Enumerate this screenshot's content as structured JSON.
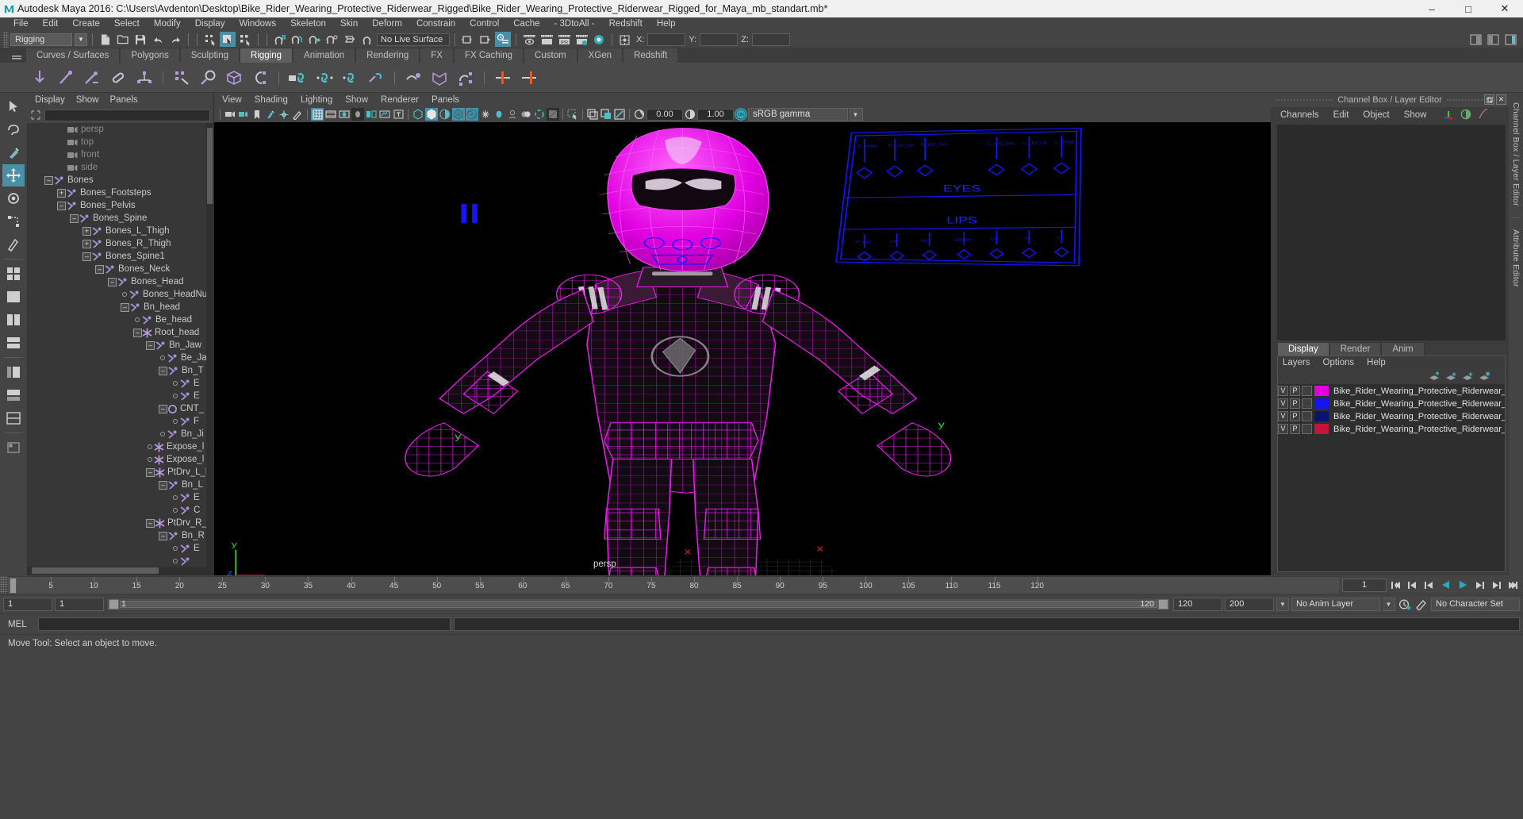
{
  "window": {
    "title": "Autodesk Maya 2016: C:\\Users\\Avdenton\\Desktop\\Bike_Rider_Wearing_Protective_Riderwear_Rigged\\Bike_Rider_Wearing_Protective_Riderwear_Rigged_for_Maya_mb_standart.mb*",
    "app_icon": "maya-logo-icon",
    "minimize": "–",
    "maximize": "□",
    "close": "✕"
  },
  "menubar": {
    "items": [
      "File",
      "Edit",
      "Create",
      "Select",
      "Modify",
      "Display",
      "Windows",
      "Skeleton",
      "Skin",
      "Deform",
      "Constrain",
      "Control",
      "Cache",
      "- 3DtoAll -",
      "Redshift",
      "Help"
    ]
  },
  "statusline": {
    "mode": "Rigging",
    "live_surface": "No Live Surface",
    "coord_labels": [
      "X:",
      "Y:",
      "Z:"
    ],
    "coord_values": [
      "",
      "",
      ""
    ]
  },
  "shelf": {
    "tabs": [
      "Curves / Surfaces",
      "Polygons",
      "Sculpting",
      "Rigging",
      "Animation",
      "Rendering",
      "FX",
      "FX Caching",
      "Custom",
      "XGen",
      "Redshift"
    ],
    "active_tab": "Rigging"
  },
  "outliner": {
    "menus": [
      "Display",
      "Show",
      "Panels"
    ],
    "search_value": "",
    "tree": [
      {
        "label": "persp",
        "depth": 2,
        "icon": "camera-icon",
        "expander": "none",
        "dim": true
      },
      {
        "label": "top",
        "depth": 2,
        "icon": "camera-icon",
        "expander": "none",
        "dim": true
      },
      {
        "label": "front",
        "depth": 2,
        "icon": "camera-icon",
        "expander": "none",
        "dim": true
      },
      {
        "label": "side",
        "depth": 2,
        "icon": "camera-icon",
        "expander": "none",
        "dim": true
      },
      {
        "label": "Bones",
        "depth": 1,
        "icon": "joint-icon",
        "expander": "minus",
        "dim": false
      },
      {
        "label": "Bones_Footsteps",
        "depth": 2,
        "icon": "joint-icon",
        "expander": "plus",
        "dim": false
      },
      {
        "label": "Bones_Pelvis",
        "depth": 2,
        "icon": "joint-icon",
        "expander": "minus",
        "dim": false
      },
      {
        "label": "Bones_Spine",
        "depth": 3,
        "icon": "joint-icon",
        "expander": "minus",
        "dim": false
      },
      {
        "label": "Bones_L_Thigh",
        "depth": 4,
        "icon": "joint-icon",
        "expander": "plus",
        "dim": false
      },
      {
        "label": "Bones_R_Thigh",
        "depth": 4,
        "icon": "joint-icon",
        "expander": "plus",
        "dim": false
      },
      {
        "label": "Bones_Spine1",
        "depth": 4,
        "icon": "joint-icon",
        "expander": "minus",
        "dim": false
      },
      {
        "label": "Bones_Neck",
        "depth": 5,
        "icon": "joint-icon",
        "expander": "minus",
        "dim": false
      },
      {
        "label": "Bones_Head",
        "depth": 6,
        "icon": "joint-icon",
        "expander": "minus",
        "dim": false
      },
      {
        "label": "Bones_HeadNub",
        "depth": 7,
        "icon": "joint-icon",
        "expander": "dot",
        "dim": false
      },
      {
        "label": "Bn_head",
        "depth": 7,
        "icon": "joint-icon",
        "expander": "minus",
        "dim": false
      },
      {
        "label": "Be_head",
        "depth": 8,
        "icon": "joint-icon",
        "expander": "dot",
        "dim": false
      },
      {
        "label": "Root_head",
        "depth": 8,
        "icon": "star-icon",
        "expander": "minus",
        "dim": false
      },
      {
        "label": "Bn_Jaw",
        "depth": 9,
        "icon": "joint-icon",
        "expander": "minus",
        "dim": false
      },
      {
        "label": "Be_Ja",
        "depth": 10,
        "icon": "joint-icon",
        "expander": "dot",
        "dim": false
      },
      {
        "label": "Bn_T",
        "depth": 10,
        "icon": "joint-icon",
        "expander": "minus",
        "dim": false
      },
      {
        "label": "E",
        "depth": 11,
        "icon": "joint-icon",
        "expander": "dot",
        "dim": false
      },
      {
        "label": "E",
        "depth": 11,
        "icon": "joint-icon",
        "expander": "dot",
        "dim": false
      },
      {
        "label": "CNT_",
        "depth": 10,
        "icon": "circle-icon",
        "expander": "minus",
        "dim": false
      },
      {
        "label": "F",
        "depth": 11,
        "icon": "joint-icon",
        "expander": "dot",
        "dim": false
      },
      {
        "label": "Bn_Ji",
        "depth": 10,
        "icon": "joint-icon",
        "expander": "dot",
        "dim": false
      },
      {
        "label": "Expose_l",
        "depth": 9,
        "icon": "star-icon",
        "expander": "dot",
        "dim": false
      },
      {
        "label": "Expose_l",
        "depth": 9,
        "icon": "star-icon",
        "expander": "dot",
        "dim": false
      },
      {
        "label": "PtDrv_L_l",
        "depth": 9,
        "icon": "star-icon",
        "expander": "minus",
        "dim": false
      },
      {
        "label": "Bn_L",
        "depth": 10,
        "icon": "joint-icon",
        "expander": "minus",
        "dim": false
      },
      {
        "label": "E",
        "depth": 11,
        "icon": "joint-icon",
        "expander": "dot",
        "dim": false
      },
      {
        "label": "C",
        "depth": 11,
        "icon": "joint-icon",
        "expander": "dot",
        "dim": false
      },
      {
        "label": "PtDrv_R_",
        "depth": 9,
        "icon": "star-icon",
        "expander": "minus",
        "dim": false
      },
      {
        "label": "Bn_R",
        "depth": 10,
        "icon": "joint-icon",
        "expander": "minus",
        "dim": false
      },
      {
        "label": "E",
        "depth": 11,
        "icon": "joint-icon",
        "expander": "dot",
        "dim": false
      },
      {
        "label": "",
        "depth": 11,
        "icon": "joint-icon",
        "expander": "dot",
        "dim": false
      }
    ]
  },
  "viewport": {
    "menus": [
      "View",
      "Shading",
      "Lighting",
      "Show",
      "Renderer",
      "Panels"
    ],
    "exposure_value": "0.00",
    "gamma_value": "1.00",
    "color_profile": "sRGB gamma",
    "camera_label": "persp",
    "axis_labels": {
      "x": "x",
      "y": "y",
      "z": "z"
    },
    "ctrl_labels": {
      "eyes": "EYES",
      "lips": "LIPS"
    }
  },
  "channelbox": {
    "title": "Channel Box / Layer Editor",
    "menus": [
      "Channels",
      "Edit",
      "Object",
      "Show"
    ],
    "tabs": [
      "Display",
      "Render",
      "Anim"
    ],
    "active_tab": "Display",
    "layer_menus": [
      "Layers",
      "Options",
      "Help"
    ],
    "layers": [
      {
        "v": "V",
        "p": "P",
        "color": "#e000e0",
        "name": "Bike_Rider_Wearing_Protective_Riderwear_Rigged_Geom"
      },
      {
        "v": "V",
        "p": "P",
        "color": "#1414f0",
        "name": "Bike_Rider_Wearing_Protective_Riderwear_Rigged_Contr"
      },
      {
        "v": "V",
        "p": "P",
        "color": "#0a1470",
        "name": "Bike_Rider_Wearing_Protective_Riderwear_Rigged_Helpe"
      },
      {
        "v": "V",
        "p": "P",
        "color": "#c4143c",
        "name": "Bike_Rider_Wearing_Protective_Riderwear_Rigged_Bones"
      }
    ]
  },
  "right_vtabs": [
    "Channel Box / Layer Editor",
    "Attribute Editor"
  ],
  "timeslider": {
    "ticks": [
      "5",
      "10",
      "15",
      "20",
      "25",
      "30",
      "35",
      "40",
      "45",
      "50",
      "55",
      "60",
      "65",
      "70",
      "75",
      "80",
      "85",
      "90",
      "95",
      "100",
      "105",
      "110",
      "115",
      "120"
    ],
    "current_frame": "1",
    "current_frame_field": "1",
    "playback_buttons": [
      "go-to-start",
      "step-back-key",
      "step-back",
      "play-backwards",
      "play-forwards",
      "step-forward",
      "step-forward-key",
      "go-to-end"
    ]
  },
  "rangeslider": {
    "start": "1",
    "anim_start": "1",
    "range_start_label": "1",
    "range_end_label": "120",
    "anim_end": "120",
    "end": "200",
    "anim_layer": "No Anim Layer",
    "character_set": "No Character Set"
  },
  "mel": {
    "label": "MEL",
    "command_value": "",
    "output_value": ""
  },
  "status": {
    "help_text": "Move Tool: Select an object to move."
  },
  "colors": {
    "accent": "#4a8fa8",
    "magenta": "#e000e0",
    "blue": "#1414f0",
    "joint": "#a890d8"
  }
}
